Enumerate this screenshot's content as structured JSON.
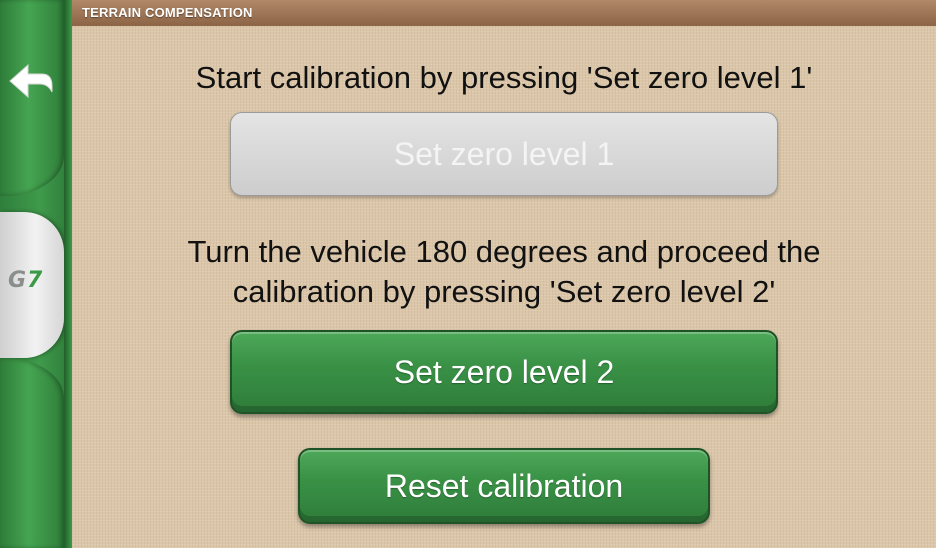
{
  "header": {
    "title": "TERRAIN COMPENSATION"
  },
  "sidebar": {
    "back_icon": "back-arrow-icon",
    "logo_text": "G7"
  },
  "main": {
    "step1_instruction": "Start calibration by pressing 'Set zero level 1'",
    "set_zero_1_label": "Set zero level 1",
    "step2_instruction_line1": "Turn the vehicle 180 degrees and proceed the",
    "step2_instruction_line2": "calibration by pressing 'Set zero level 2'",
    "set_zero_2_label": "Set zero level 2",
    "reset_label": "Reset calibration"
  },
  "colors": {
    "accent_green": "#3a9246",
    "title_brown": "#8c6446",
    "background_tan": "#dbc6a9",
    "disabled_gray": "#d6d6d6"
  }
}
